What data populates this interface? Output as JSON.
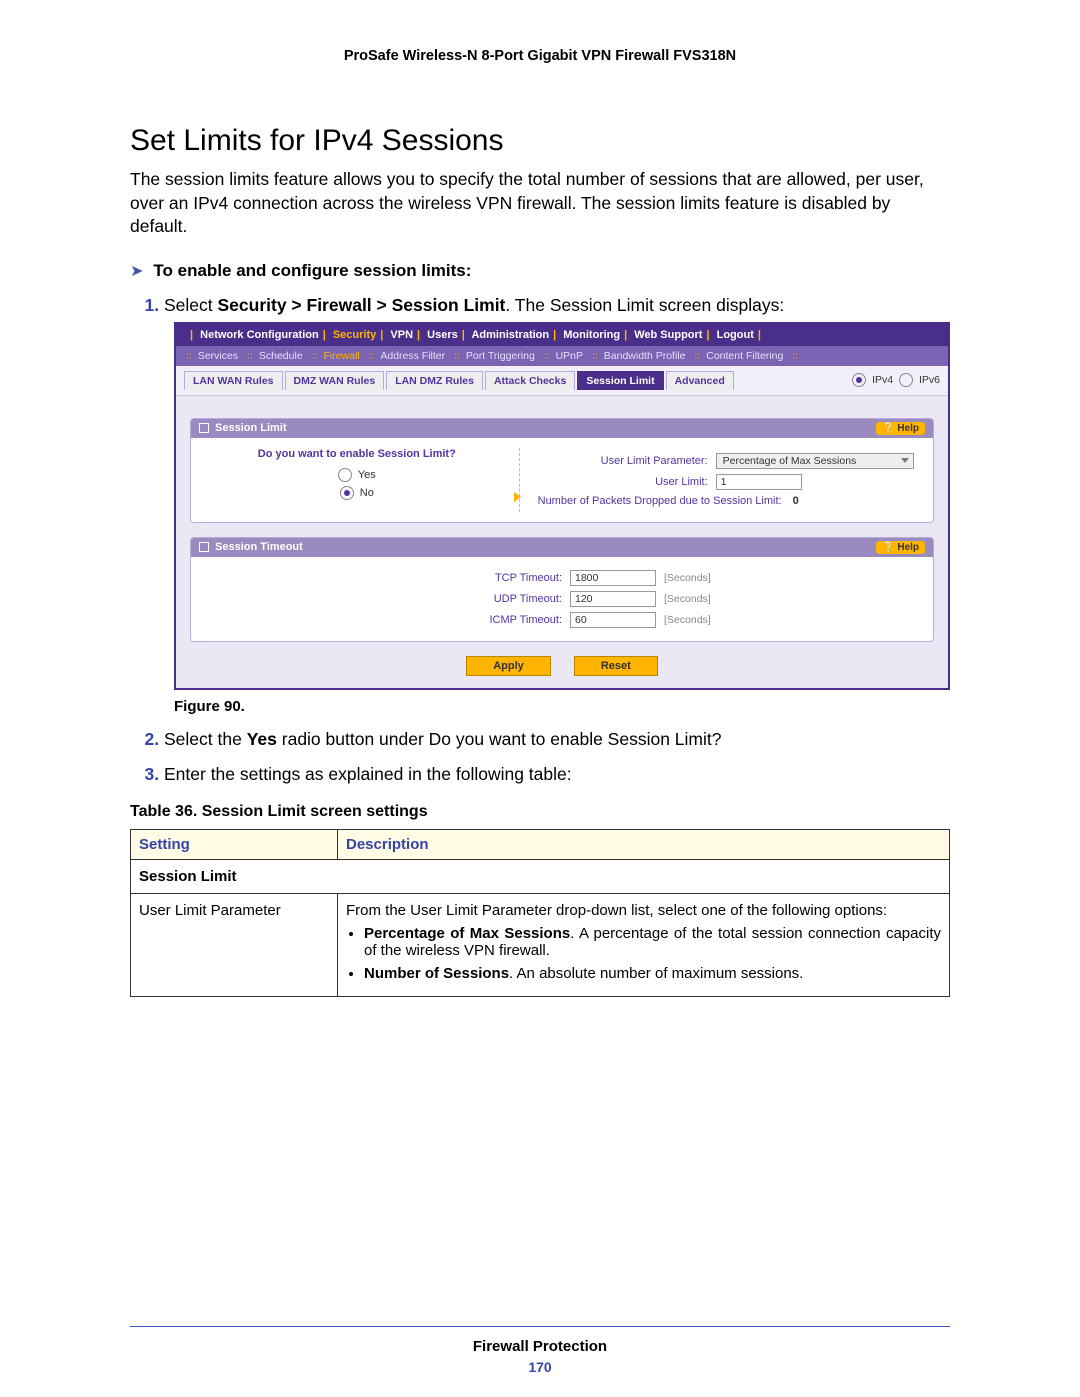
{
  "doc_header": "ProSafe Wireless-N 8-Port Gigabit VPN Firewall FVS318N",
  "h1": "Set Limits for IPv4 Sessions",
  "intro": "The session limits feature allows you to specify the total number of sessions that are allowed, per user, over an IPv4 connection across the wireless VPN firewall. The session limits feature is disabled by default.",
  "proc_head": "To enable and configure session limits:",
  "step1_a": "Select ",
  "step1_b": "Security > Firewall > Session Limit",
  "step1_c": ". The Session Limit screen displays:",
  "step2_a": "Select the ",
  "step2_b": "Yes",
  "step2_c": " radio button under Do you want to enable Session Limit?",
  "step3": "Enter the settings as explained in the following table:",
  "fig_caption": "Figure 90.",
  "tbl_caption": "Table 36.  Session Limit screen settings",
  "tbl": {
    "h1": "Setting",
    "h2": "Description",
    "section": "Session Limit",
    "r1c1": "User Limit Parameter",
    "r1c2": "From the User Limit Parameter drop-down list, select one of the following options:",
    "r1b1a": "Percentage of Max Sessions",
    "r1b1b": ". A percentage of the total session connection capacity of the wireless VPN firewall.",
    "r1b2a": "Number of Sessions",
    "r1b2b": ". An absolute number of maximum sessions."
  },
  "shot": {
    "topnav": [
      "Network Configuration",
      "Security",
      "VPN",
      "Users",
      "Administration",
      "Monitoring",
      "Web Support",
      "Logout"
    ],
    "topnav_active": "Security",
    "subnav": [
      "Services",
      "Schedule",
      "Firewall",
      "Address Filter",
      "Port Triggering",
      "UPnP",
      "Bandwidth Profile",
      "Content Filtering"
    ],
    "subnav_active": "Firewall",
    "tabs": [
      "LAN WAN Rules",
      "DMZ WAN Rules",
      "LAN DMZ Rules",
      "Attack Checks",
      "Session Limit",
      "Advanced"
    ],
    "tab_active": "Session Limit",
    "ipv4": "IPv4",
    "ipv6": "IPv6",
    "panel1_title": "Session Limit",
    "panel2_title": "Session Timeout",
    "help": "Help",
    "question": "Do you want to enable Session Limit?",
    "opt_yes": "Yes",
    "opt_no": "No",
    "ulp_label": "User Limit Parameter:",
    "ulp_value": "Percentage of Max Sessions",
    "ul_label": "User Limit:",
    "ul_value": "1",
    "drop_label": "Number of Packets Dropped due to Session Limit:",
    "drop_value": "0",
    "tcp_l": "TCP Timeout:",
    "tcp_v": "1800",
    "udp_l": "UDP Timeout:",
    "udp_v": "120",
    "icmp_l": "ICMP Timeout:",
    "icmp_v": "60",
    "sec": "[Seconds]",
    "apply": "Apply",
    "reset": "Reset"
  },
  "footer_title": "Firewall Protection",
  "footer_page": "170"
}
